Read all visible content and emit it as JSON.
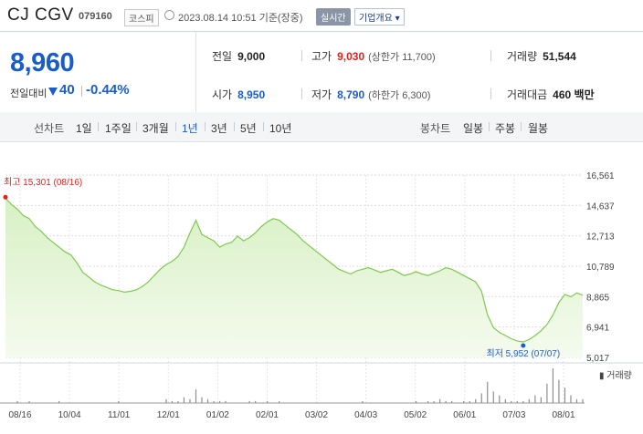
{
  "header": {
    "name": "CJ CGV",
    "code": "079160",
    "market": "코스피",
    "datetime": "2023.08.14 10:51  기준(장중)",
    "realtime": "실시간",
    "company": "기업개요 ▾"
  },
  "quote": {
    "price": "8,960",
    "prev_label": "전일대비",
    "change": "40",
    "pct": "-0.44%",
    "prev_close_label": "전일",
    "prev_close": "9,000",
    "high_label": "고가",
    "high": "9,030",
    "upper_limit": "(상한가 11,700)",
    "volume_label": "거래량",
    "volume": "51,544",
    "open_label": "시가",
    "open": "8,950",
    "low_label": "저가",
    "low": "8,790",
    "lower_limit": "(하한가 6,300)",
    "amount_label": "거래대금",
    "amount": "460 백만"
  },
  "tabs": {
    "line_label": "선차트",
    "line": [
      "1일",
      "1주일",
      "3개월",
      "1년",
      "3년",
      "5년",
      "10년"
    ],
    "selected": "1년",
    "candle_label": "봉차트",
    "candle": [
      "일봉",
      "주봉",
      "월봉"
    ]
  },
  "chart_data": {
    "type": "area",
    "y_ticks": [
      "16,561",
      "14,637",
      "12,713",
      "10,789",
      "8,865",
      "6,941",
      "5,017"
    ],
    "ylim": [
      5017,
      16561
    ],
    "x_ticks": [
      "08/16",
      "10/04",
      "11/01",
      "12/01",
      "01/02",
      "02/01",
      "03/02",
      "04/03",
      "05/02",
      "06/01",
      "07/03",
      "08/01"
    ],
    "max_label": "최고 15,301 (08/16)",
    "min_label": "최저 5,952 (07/07)",
    "volume_label": "거래량",
    "series": [
      {
        "values": [
          15100,
          14700,
          14400,
          14000,
          13800,
          13300,
          13000,
          12600,
          12300,
          12000,
          11700,
          11500,
          11000,
          10400,
          10100,
          9800,
          9600,
          9450,
          9300,
          9250,
          9150,
          9200,
          9300,
          9500,
          9800,
          10200,
          10600,
          10900,
          11100,
          11400,
          12000,
          12900,
          13700,
          12800,
          12600,
          12400,
          12000,
          12200,
          12300,
          12700,
          12400,
          12600,
          12900,
          13300,
          13600,
          13800,
          13700,
          13400,
          13100,
          12800,
          12400,
          12100,
          11800,
          11500,
          11200,
          10900,
          10600,
          10450,
          10300,
          10500,
          10600,
          10700,
          10550,
          10400,
          10500,
          10600,
          10400,
          10200,
          10300,
          10450,
          10300,
          10200,
          10350,
          10500,
          10700,
          10600,
          10400,
          10200,
          10000,
          9800,
          9200,
          7700,
          6900,
          6600,
          6400,
          6200,
          6050,
          6000,
          6150,
          6400,
          6700,
          7100,
          7700,
          8500,
          9000,
          8850,
          9100,
          8960
        ]
      },
      {
        "name": "거래량",
        "values": [
          0,
          0,
          1,
          0,
          1,
          0,
          0,
          0,
          0,
          1,
          0,
          0,
          0,
          0,
          0,
          0,
          0,
          0,
          0,
          1,
          0,
          0,
          0,
          0,
          0,
          0,
          0,
          2,
          1,
          1,
          3,
          2,
          7,
          3,
          2,
          1,
          1,
          1,
          0,
          0,
          0,
          1,
          1,
          0,
          1,
          0,
          1,
          0,
          0,
          0,
          0,
          0,
          0,
          0,
          0,
          0,
          0,
          0,
          0,
          0,
          1,
          0,
          0,
          0,
          0,
          0,
          0,
          0,
          0,
          1,
          0,
          1,
          1,
          2,
          1,
          1,
          0,
          1,
          1,
          2,
          5,
          11,
          6,
          4,
          2,
          1,
          1,
          1,
          2,
          4,
          3,
          10,
          18,
          12,
          8,
          4,
          2,
          2
        ]
      }
    ]
  }
}
